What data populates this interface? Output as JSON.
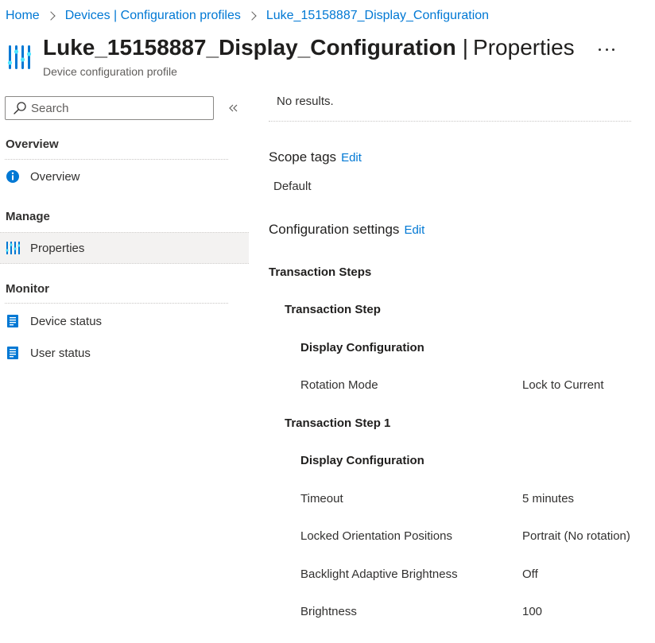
{
  "breadcrumb": [
    "Home",
    "Devices | Configuration profiles",
    "Luke_15158887_Display_Configuration"
  ],
  "header": {
    "title_name": "Luke_15158887_Display_Configuration",
    "title_separator": "|",
    "title_section": "Properties",
    "subtitle": "Device configuration profile",
    "more_label": "..."
  },
  "sidebar": {
    "search_placeholder": "Search",
    "groups": {
      "overview": "Overview",
      "manage": "Manage",
      "monitor": "Monitor"
    },
    "items": {
      "overview": "Overview",
      "properties": "Properties",
      "device_status": "Device status",
      "user_status": "User status"
    }
  },
  "main": {
    "no_results": "No results.",
    "scope_tags": {
      "title": "Scope tags",
      "edit": "Edit",
      "value": "Default"
    },
    "config_settings": {
      "title": "Configuration settings",
      "edit": "Edit"
    },
    "transaction_steps_title": "Transaction Steps",
    "steps": [
      {
        "title": "Transaction Step",
        "group": "Display Configuration",
        "settings": [
          {
            "label": "Rotation Mode",
            "value": "Lock to Current"
          }
        ]
      },
      {
        "title": "Transaction Step 1",
        "group": "Display Configuration",
        "settings": [
          {
            "label": "Timeout",
            "value": "5 minutes"
          },
          {
            "label": "Locked Orientation Positions",
            "value": "Portrait (No rotation)"
          },
          {
            "label": "Backlight Adaptive Brightness",
            "value": "Off"
          },
          {
            "label": "Brightness",
            "value": "100"
          }
        ]
      }
    ]
  },
  "colors": {
    "link": "#0078d4",
    "text": "#323130",
    "selected_bg": "#f3f2f1",
    "icon_blue": "#0078d4"
  }
}
